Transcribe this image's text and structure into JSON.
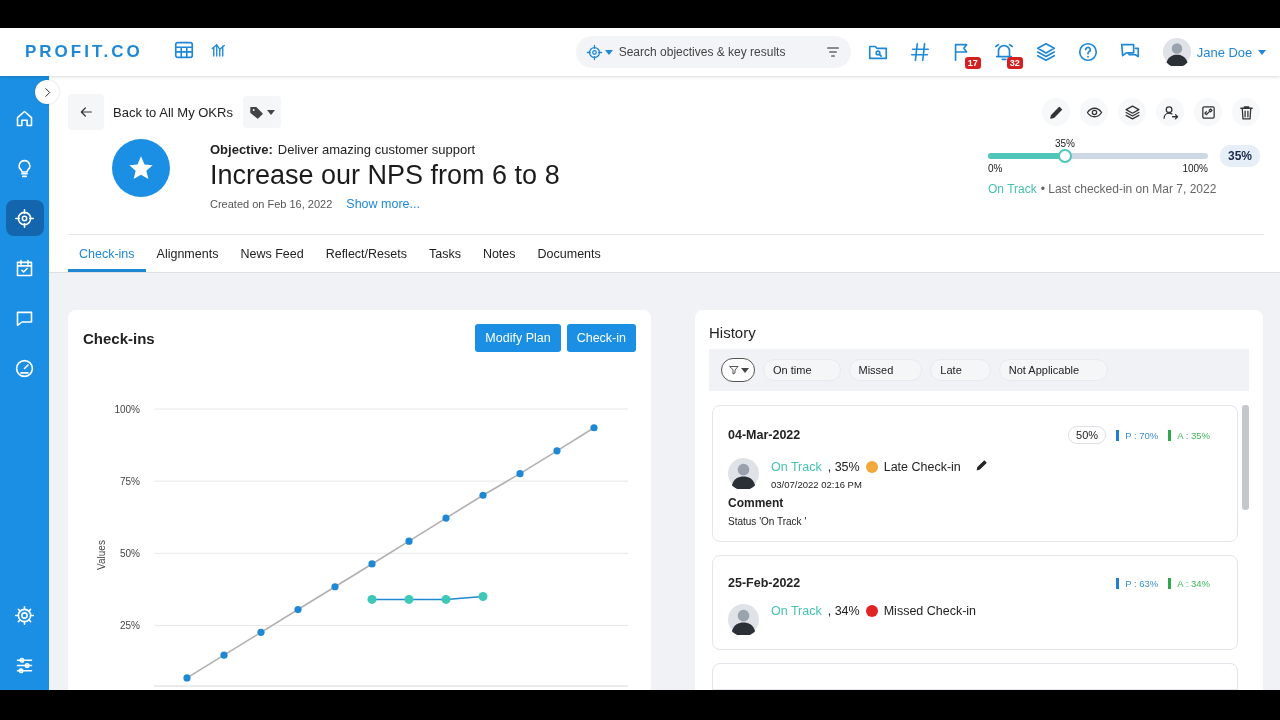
{
  "header": {
    "logo": "PROFIT.CO",
    "search": {
      "placeholder": "Search objectives & key results"
    },
    "badges": [
      {
        "kind": "flag",
        "count": "17"
      },
      {
        "kind": "alarm",
        "count": "32"
      }
    ],
    "user": "Jane Doe"
  },
  "sidebar": {
    "items": [
      {
        "kind": "home",
        "selected": false
      },
      {
        "kind": "bulb",
        "selected": false
      },
      {
        "kind": "target",
        "selected": true
      },
      {
        "kind": "calendar",
        "selected": false
      },
      {
        "kind": "chat",
        "selected": false
      },
      {
        "kind": "gauge",
        "selected": false
      }
    ],
    "bottom": [
      {
        "kind": "gear",
        "selected": false
      },
      {
        "kind": "sliders",
        "selected": false
      }
    ]
  },
  "back_link": "Back to All My OKRs",
  "objective": {
    "label": "Objective:",
    "parent": "Deliver amazing customer support",
    "title": "Increase our NPS from 6 to 8",
    "created": "Created on Feb 16, 2022",
    "show_more": "Show more..."
  },
  "progress": {
    "level": 0.35,
    "reading": "35%",
    "min": "0%",
    "max": "100%",
    "badge": "35%",
    "status": "On Track",
    "last_checkin": "• Last checked-in on Mar 7, 2022"
  },
  "tabs": [
    {
      "label": "Check-ins",
      "selected": true
    },
    {
      "label": "Alignments",
      "selected": false
    },
    {
      "label": "News Feed",
      "selected": false
    },
    {
      "label": "Reflect/Resets",
      "selected": false
    },
    {
      "label": "Tasks",
      "selected": false
    },
    {
      "label": "Notes",
      "selected": false
    },
    {
      "label": "Documents",
      "selected": false
    }
  ],
  "checkins": {
    "title": "Check-ins",
    "buttons": [
      "Modify Plan",
      "Check-in"
    ],
    "chart_data": {
      "type": "line",
      "ylabel": "Values",
      "grid": true,
      "ylim": [
        4,
        100
      ],
      "yticks": [
        {
          "value": 25,
          "label": "25%"
        },
        {
          "value": 50,
          "label": "50%"
        },
        {
          "value": 75,
          "label": "75%"
        },
        {
          "value": 100,
          "label": "100%"
        }
      ],
      "series": [
        {
          "color": "#1f88d2",
          "marker": true,
          "values": [
            6.8,
            14.7,
            22.6,
            30.5,
            38.4,
            46.3,
            54.2,
            62.2,
            70.1,
            77.6,
            85.5,
            93.5
          ]
        },
        {
          "color": "#1f88d2",
          "marker": true,
          "values": [
            null,
            null,
            null,
            null,
            null,
            34,
            34,
            34,
            35,
            null,
            null,
            null
          ]
        }
      ]
    }
  },
  "history": {
    "title": "History",
    "filters": [
      "On time",
      "Missed",
      "Late",
      "Not Applicable"
    ],
    "entries": [
      {
        "date": "04-Mar-2022",
        "badge": "50%",
        "planned": "P : 70%",
        "actual": "A : 35%",
        "status": "On Track",
        "percent": ", 35%",
        "color": "#f0a83a",
        "type": "Late Check-in",
        "editable": true,
        "timestamp": "03/07/2022 02:16 PM",
        "comment_heading": "Comment",
        "comment": "Status 'On Track '"
      },
      {
        "date": "25-Feb-2022",
        "planned": "P : 63%",
        "actual": "A : 34%",
        "status": "On Track",
        "percent": ", 34%",
        "color": "#e02424",
        "type": "Missed Check-in",
        "editable": false
      }
    ]
  }
}
